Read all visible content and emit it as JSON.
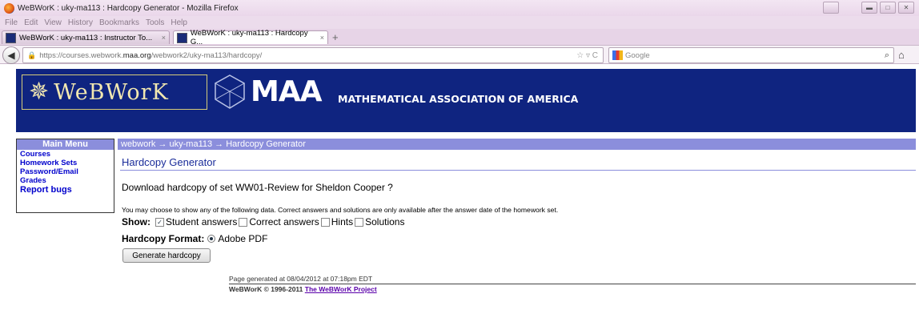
{
  "window": {
    "title": "WeBWorK : uky-ma113 : Hardcopy Generator - Mozilla Firefox"
  },
  "menu": [
    "File",
    "Edit",
    "View",
    "History",
    "Bookmarks",
    "Tools",
    "Help"
  ],
  "tabs": [
    {
      "label": "WeBWorK : uky-ma113 : Instructor To...",
      "active": false
    },
    {
      "label": "WeBWorK : uky-ma113 : Hardcopy G...",
      "active": true
    }
  ],
  "nav": {
    "url_prefix": "https://courses.webwork.",
    "url_host": "maa.org",
    "url_suffix": "/webwork2/uky-ma113/hardcopy/",
    "search_placeholder": "Google"
  },
  "banner": {
    "logo": "WeBWorK",
    "maa": "MAA",
    "maa_full": "MATHEMATICAL ASSOCIATION OF AMERICA"
  },
  "sidebar": {
    "header": "Main Menu",
    "links": [
      "Courses",
      "Homework Sets",
      "Password/Email",
      "Grades"
    ],
    "report": "Report bugs"
  },
  "breadcrumb": "webwork → uky-ma113 → Hardcopy Generator",
  "page": {
    "title": "Hardcopy Generator",
    "question": "Download hardcopy of set WW01-Review for Sheldon Cooper ?",
    "note": "You may choose to show any of the following data. Correct answers and solutions are only available after the answer date of the homework set.",
    "show_label": "Show:",
    "options": [
      {
        "label": "Student answers",
        "checked": true
      },
      {
        "label": "Correct answers",
        "checked": false
      },
      {
        "label": "Hints",
        "checked": false
      },
      {
        "label": "Solutions",
        "checked": false
      }
    ],
    "format_label": "Hardcopy Format:",
    "format_value": "Adobe PDF",
    "button": "Generate hardcopy"
  },
  "footer": {
    "generated": "Page generated at 08/04/2012 at 07:18pm EDT",
    "copyright": "WeBWorK © 1996-2011",
    "link": "The WeBWorK Project"
  }
}
